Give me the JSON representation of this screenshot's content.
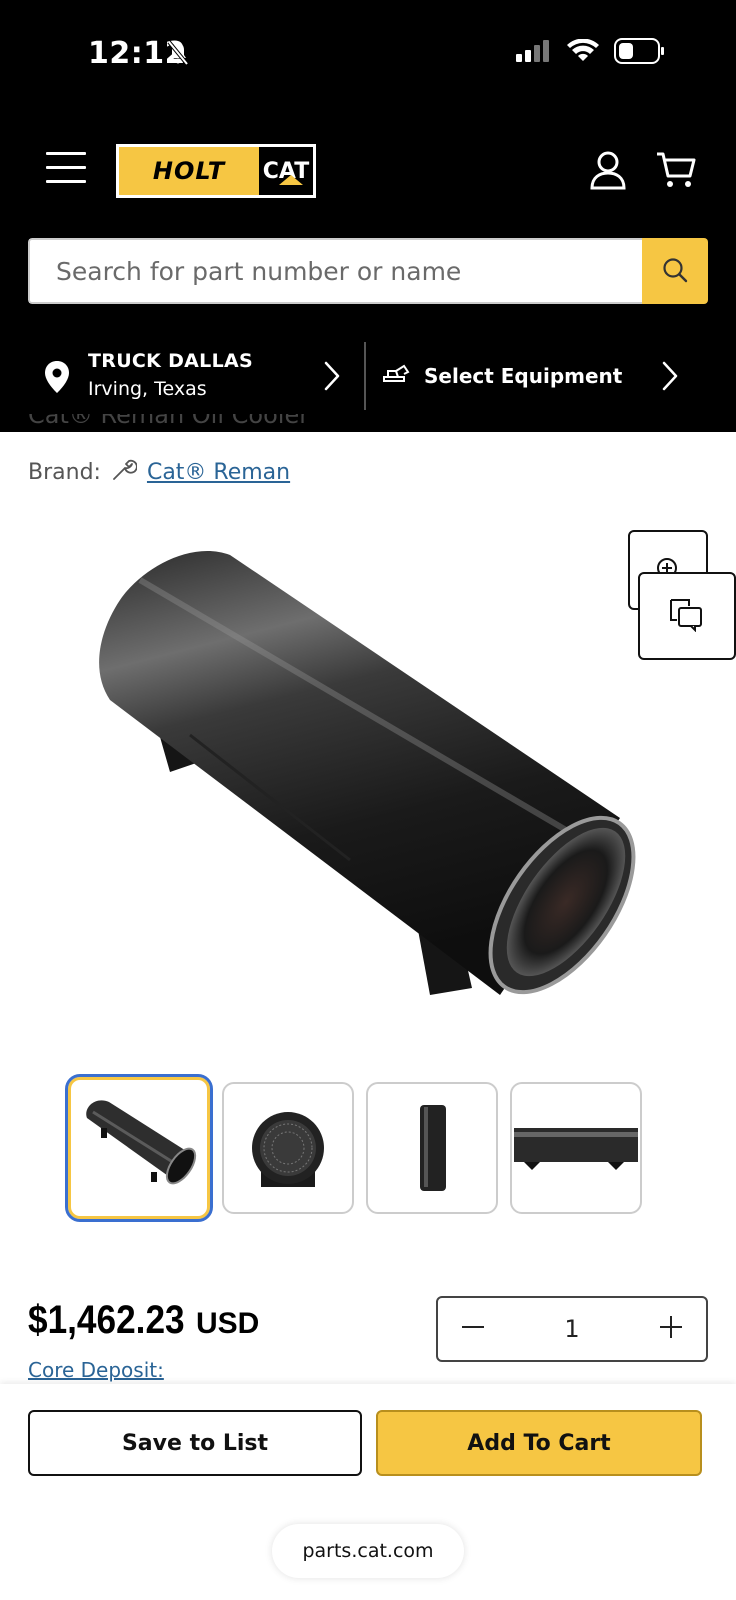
{
  "status_bar": {
    "time": "12:12",
    "icons": [
      "bell-slash-icon",
      "cellular-signal-icon",
      "wifi-icon",
      "battery-icon"
    ]
  },
  "header": {
    "menu_icon": "hamburger-menu-icon",
    "logo": {
      "holt": "HOLT",
      "cat": "CAT"
    },
    "account_icon": "user-icon",
    "cart_icon": "cart-icon"
  },
  "search": {
    "placeholder": "Search for part number or name",
    "value": "",
    "button_icon": "search-icon"
  },
  "location": {
    "store_name": "TRUCK DALLAS",
    "store_city": "Irving, Texas",
    "equipment_label": "Select Equipment"
  },
  "product": {
    "title_partial": "Cat® Reman Oil Cooler",
    "brand_label": "Brand:",
    "brand_name": "Cat® Reman",
    "thumbnails": [
      "Thumbnail 1",
      "Thumbnail 2",
      "Thumbnail 3",
      "Thumbnail 4"
    ],
    "price": "$1,462.23",
    "currency": "USD",
    "core_deposit_label": "Core Deposit:",
    "quantity": "1"
  },
  "actions": {
    "save_label": "Save to List",
    "add_to_cart_label": "Add To Cart"
  },
  "browser": {
    "url": "parts.cat.com"
  },
  "colors": {
    "brand_yellow": "#f6c643",
    "header_black": "#000000",
    "link_blue": "#2a6496",
    "thumb_selected_outline": "#3a6fd0"
  }
}
